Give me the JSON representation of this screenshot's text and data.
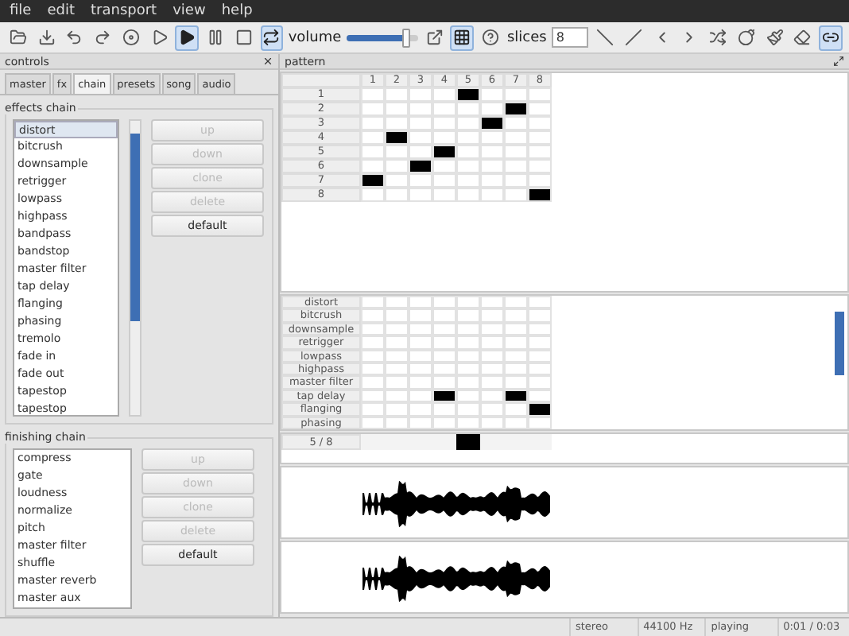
{
  "menu": [
    "file",
    "edit",
    "transport",
    "view",
    "help"
  ],
  "toolbar": [
    {
      "kind": "open",
      "on": false
    },
    {
      "kind": "save",
      "on": false
    },
    {
      "kind": "undo",
      "on": false
    },
    {
      "kind": "redo",
      "on": false
    },
    {
      "kind": "record",
      "on": false
    },
    {
      "kind": "play",
      "on": false
    },
    {
      "kind": "playfilled",
      "on": true
    },
    {
      "kind": "pause",
      "on": false
    },
    {
      "kind": "stop",
      "on": false
    },
    {
      "kind": "loop",
      "on": true
    }
  ],
  "volume": {
    "label": "volume",
    "level": 0.85
  },
  "toolbar2": [
    {
      "kind": "popout",
      "on": false
    },
    {
      "kind": "grid",
      "on": true
    },
    {
      "kind": "help",
      "on": false
    }
  ],
  "slices": {
    "label": "slices",
    "value": "8"
  },
  "toolbar3": [
    {
      "kind": "linedown",
      "on": false
    },
    {
      "kind": "lineup",
      "on": false
    },
    {
      "kind": "left",
      "on": false
    },
    {
      "kind": "right",
      "on": false
    },
    {
      "kind": "shuffle",
      "on": false
    },
    {
      "kind": "bomb",
      "on": false
    },
    {
      "kind": "brush",
      "on": false
    },
    {
      "kind": "eraser",
      "on": false
    },
    {
      "kind": "link",
      "on": true
    }
  ],
  "controls": {
    "title": "controls",
    "tabs": [
      {
        "label": "master",
        "selected": false
      },
      {
        "label": "fx",
        "selected": false
      },
      {
        "label": "chain",
        "selected": true
      },
      {
        "label": "presets",
        "selected": false
      },
      {
        "label": "song",
        "selected": false
      },
      {
        "label": "audio",
        "selected": false
      }
    ],
    "groups": [
      {
        "title": "effects chain",
        "scrollbar": true,
        "items": [
          {
            "label": "distort",
            "selected": true
          },
          {
            "label": "bitcrush",
            "selected": false
          },
          {
            "label": "downsample",
            "selected": false
          },
          {
            "label": "retrigger",
            "selected": false
          },
          {
            "label": "lowpass",
            "selected": false
          },
          {
            "label": "highpass",
            "selected": false
          },
          {
            "label": "bandpass",
            "selected": false
          },
          {
            "label": "bandstop",
            "selected": false
          },
          {
            "label": "master filter",
            "selected": false
          },
          {
            "label": "tap delay",
            "selected": false
          },
          {
            "label": "flanging",
            "selected": false
          },
          {
            "label": "phasing",
            "selected": false
          },
          {
            "label": "tremolo",
            "selected": false
          },
          {
            "label": "fade in",
            "selected": false
          },
          {
            "label": "fade out",
            "selected": false
          },
          {
            "label": "tapestop",
            "selected": false
          },
          {
            "label": "tapestop",
            "selected": false
          }
        ],
        "buttons": [
          {
            "label": "up",
            "disabled": true
          },
          {
            "label": "down",
            "disabled": true
          },
          {
            "label": "clone",
            "disabled": true
          },
          {
            "label": "delete",
            "disabled": true
          },
          {
            "label": "default",
            "disabled": false
          }
        ]
      },
      {
        "title": "finishing chain",
        "scrollbar": false,
        "items": [
          {
            "label": "compress",
            "selected": false
          },
          {
            "label": "gate",
            "selected": false
          },
          {
            "label": "loudness",
            "selected": false
          },
          {
            "label": "normalize",
            "selected": false
          },
          {
            "label": "pitch",
            "selected": false
          },
          {
            "label": "master filter",
            "selected": false
          },
          {
            "label": "shuffle",
            "selected": false
          },
          {
            "label": "master reverb",
            "selected": false
          },
          {
            "label": "master aux",
            "selected": false
          }
        ],
        "buttons": [
          {
            "label": "up",
            "disabled": true
          },
          {
            "label": "down",
            "disabled": true
          },
          {
            "label": "clone",
            "disabled": true
          },
          {
            "label": "delete",
            "disabled": true
          },
          {
            "label": "default",
            "disabled": false
          }
        ]
      }
    ]
  },
  "pattern": {
    "title": "pattern",
    "columns": [
      "1",
      "2",
      "3",
      "4",
      "5",
      "6",
      "7",
      "8"
    ],
    "rows": [
      {
        "label": "1",
        "cells": [
          false,
          false,
          false,
          false,
          true,
          false,
          false,
          false
        ]
      },
      {
        "label": "2",
        "cells": [
          false,
          false,
          false,
          false,
          false,
          false,
          true,
          false
        ]
      },
      {
        "label": "3",
        "cells": [
          false,
          false,
          false,
          false,
          false,
          true,
          false,
          false
        ]
      },
      {
        "label": "4",
        "cells": [
          false,
          true,
          false,
          false,
          false,
          false,
          false,
          false
        ]
      },
      {
        "label": "5",
        "cells": [
          false,
          false,
          false,
          true,
          false,
          false,
          false,
          false
        ]
      },
      {
        "label": "6",
        "cells": [
          false,
          false,
          true,
          false,
          false,
          false,
          false,
          false
        ]
      },
      {
        "label": "7",
        "cells": [
          true,
          false,
          false,
          false,
          false,
          false,
          false,
          false
        ]
      },
      {
        "label": "8",
        "cells": [
          false,
          false,
          false,
          false,
          false,
          false,
          false,
          true
        ]
      }
    ]
  },
  "effects_grid": {
    "rows": [
      {
        "label": "distort",
        "cells": [
          false,
          false,
          false,
          false,
          false,
          false,
          false,
          false
        ]
      },
      {
        "label": "bitcrush",
        "cells": [
          false,
          false,
          false,
          false,
          false,
          false,
          false,
          false
        ]
      },
      {
        "label": "downsample",
        "cells": [
          false,
          false,
          false,
          false,
          false,
          false,
          false,
          false
        ]
      },
      {
        "label": "retrigger",
        "cells": [
          false,
          false,
          false,
          false,
          false,
          false,
          false,
          false
        ]
      },
      {
        "label": "lowpass",
        "cells": [
          false,
          false,
          false,
          false,
          false,
          false,
          false,
          false
        ]
      },
      {
        "label": "highpass",
        "cells": [
          false,
          false,
          false,
          false,
          false,
          false,
          false,
          false
        ]
      },
      {
        "label": "master filter",
        "cells": [
          false,
          false,
          false,
          false,
          false,
          false,
          false,
          false
        ]
      },
      {
        "label": "tap delay",
        "cells": [
          false,
          false,
          false,
          true,
          false,
          false,
          true,
          false
        ]
      },
      {
        "label": "flanging",
        "cells": [
          false,
          false,
          false,
          false,
          false,
          false,
          false,
          true
        ]
      },
      {
        "label": "phasing",
        "cells": [
          false,
          false,
          false,
          false,
          false,
          false,
          false,
          false
        ]
      }
    ]
  },
  "position": {
    "label": "5 / 8",
    "cells": [
      false,
      false,
      false,
      false,
      true,
      false,
      false,
      false
    ]
  },
  "status_bar": [
    "stereo",
    "44100 Hz",
    "playing",
    "0:01 / 0:03"
  ]
}
